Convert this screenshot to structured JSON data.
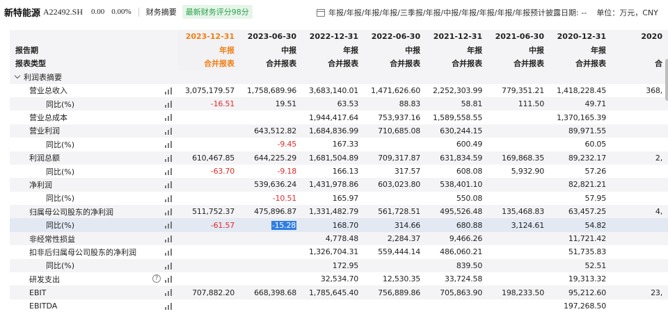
{
  "header": {
    "company": "新特能源",
    "code": "A22492.SH",
    "price": "0.00",
    "change": "0.00%",
    "tab": "财务摘要",
    "badge": "最新财务评分98分",
    "report_filter": "年报/年报/年报/年报/三季报/年报/中报/年报/年报/年报/年报预计披露日期: --",
    "unit": "单位：万元，CNY"
  },
  "table": {
    "row_labels": {
      "period": "报告期",
      "type": "报表类型"
    },
    "columns": [
      {
        "date": "2023-12-31",
        "period": "年报",
        "type": "合并报表"
      },
      {
        "date": "2023-06-30",
        "period": "中报",
        "type": "合并报表"
      },
      {
        "date": "2022-12-31",
        "period": "年报",
        "type": "合并报表"
      },
      {
        "date": "2022-06-30",
        "period": "中报",
        "type": "合并报表"
      },
      {
        "date": "2021-12-31",
        "period": "年报",
        "type": "合并报表"
      },
      {
        "date": "2021-06-30",
        "period": "中报",
        "type": "合并报表"
      },
      {
        "date": "2020-12-31",
        "period": "年报",
        "type": "合并报表"
      },
      {
        "date": "2020",
        "period": "",
        "type": "合"
      }
    ],
    "section": "利润表摘要",
    "rows": [
      {
        "label": "营业总收入",
        "indent": 1,
        "values": [
          "3,075,179.57",
          "1,758,689.96",
          "3,683,140.01",
          "1,471,626.60",
          "2,252,303.99",
          "779,351.21",
          "1,418,228.45",
          "368,"
        ]
      },
      {
        "label": "同比(%)",
        "indent": 2,
        "values": [
          "-16.51",
          "19.51",
          "63.53",
          "88.83",
          "58.81",
          "111.50",
          "49.71",
          ""
        ]
      },
      {
        "label": "营业总成本",
        "indent": 1,
        "values": [
          "",
          "",
          "1,944,417.64",
          "753,937.16",
          "1,589,558.55",
          "",
          "1,370,165.39",
          ""
        ]
      },
      {
        "label": "营业利润",
        "indent": 1,
        "values": [
          "",
          "643,512.82",
          "1,684,836.99",
          "710,685.08",
          "630,244.15",
          "",
          "89,971.55",
          ""
        ]
      },
      {
        "label": "同比(%)",
        "indent": 2,
        "values": [
          "",
          "-9.45",
          "167.33",
          "",
          "600.49",
          "",
          "60.05",
          ""
        ]
      },
      {
        "label": "利润总额",
        "indent": 1,
        "values": [
          "610,467.85",
          "644,225.29",
          "1,681,504.89",
          "709,317.87",
          "631,834.59",
          "169,868.35",
          "89,232.17",
          "2,"
        ]
      },
      {
        "label": "同比(%)",
        "indent": 2,
        "values": [
          "-63.70",
          "-9.18",
          "166.13",
          "317.57",
          "608.08",
          "5,932.90",
          "57.26",
          ""
        ]
      },
      {
        "label": "净利润",
        "indent": 1,
        "values": [
          "",
          "539,636.24",
          "1,431,978.86",
          "603,023.80",
          "538,401.10",
          "",
          "82,821.21",
          ""
        ]
      },
      {
        "label": "同比(%)",
        "indent": 2,
        "values": [
          "",
          "-10.51",
          "165.97",
          "",
          "550.08",
          "",
          "57.95",
          ""
        ]
      },
      {
        "label": "归属母公司股东的净利润",
        "indent": 1,
        "values": [
          "511,752.37",
          "475,896.87",
          "1,331,482.79",
          "561,728.51",
          "495,526.48",
          "135,468.83",
          "63,457.25",
          "4,"
        ]
      },
      {
        "label": "同比(%)",
        "indent": 2,
        "values": [
          "-61.57",
          "-15.28",
          "168.70",
          "314.66",
          "680.88",
          "3,124.61",
          "54.82",
          ""
        ]
      },
      {
        "label": "非经常性损益",
        "indent": 1,
        "values": [
          "",
          "",
          "4,778.48",
          "2,284.37",
          "9,466.26",
          "",
          "11,721.42",
          ""
        ]
      },
      {
        "label": "扣非后归属母公司股东的净利润",
        "indent": 1,
        "values": [
          "",
          "",
          "1,326,704.31",
          "559,444.14",
          "486,060.21",
          "",
          "51,735.83",
          ""
        ]
      },
      {
        "label": "同比(%)",
        "indent": 2,
        "values": [
          "",
          "",
          "172.95",
          "",
          "839.50",
          "",
          "52.51",
          ""
        ]
      },
      {
        "label": "研发支出",
        "indent": 1,
        "values": [
          "",
          "",
          "32,534.70",
          "12,530.35",
          "33,724.58",
          "",
          "19,313.32",
          ""
        ]
      },
      {
        "label": "EBIT",
        "indent": 1,
        "values": [
          "707,882.20",
          "668,398.68",
          "1,785,645.40",
          "756,889.86",
          "705,863.90",
          "198,233.50",
          "95,212.60",
          "23,"
        ]
      },
      {
        "label": "EBITDA",
        "indent": 1,
        "values": [
          "",
          "",
          "",
          "",
          "",
          "",
          "197,268.50",
          ""
        ]
      }
    ]
  }
}
